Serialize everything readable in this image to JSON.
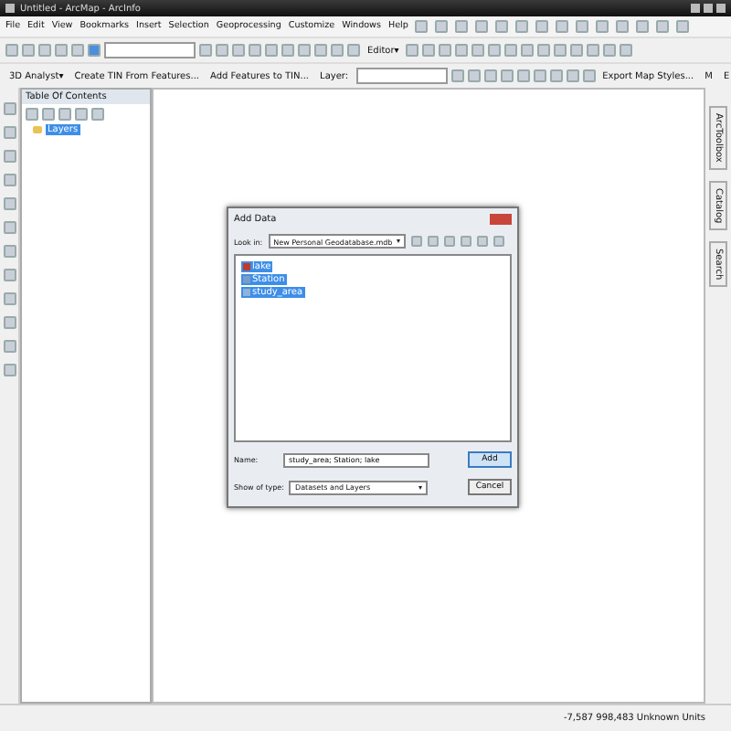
{
  "window": {
    "title": "Untitled - ArcMap - ArcInfo"
  },
  "menu": [
    "File",
    "Edit",
    "View",
    "Bookmarks",
    "Insert",
    "Selection",
    "Geoprocessing",
    "Customize",
    "Windows",
    "Help"
  ],
  "toolbars": {
    "editor_menu": "Editor▾",
    "analyst_menu": "3D Analyst▾",
    "create_tin": "Create TIN From Features...",
    "add_features": "Add Features to TIN...",
    "layer_label": "Layer:",
    "export_styles": "Export Map Styles...",
    "tool_m": "M",
    "tool_e": "E"
  },
  "toc": {
    "title": "Table Of Contents",
    "layers": [
      {
        "label": "Layers",
        "selected": true
      }
    ]
  },
  "side_tabs": [
    "ArcToolbox",
    "Catalog",
    "Search"
  ],
  "dialog": {
    "title": "Add Data",
    "look_in_label": "Look in:",
    "look_in": "New Personal Geodatabase.mdb",
    "items": [
      {
        "label": "lake",
        "kind": "raster",
        "selected": true
      },
      {
        "label": "Station",
        "kind": "point",
        "selected": true
      },
      {
        "label": "study_area",
        "kind": "polygon",
        "selected": true
      }
    ],
    "name_label": "Name:",
    "name_value": "study_area; Station; lake",
    "type_label": "Show of type:",
    "type_value": "Datasets and Layers",
    "buttons": [
      "Add",
      "Cancel"
    ]
  },
  "status_bar": {
    "coordinates": "-7,587  998,483 Unknown Units"
  }
}
